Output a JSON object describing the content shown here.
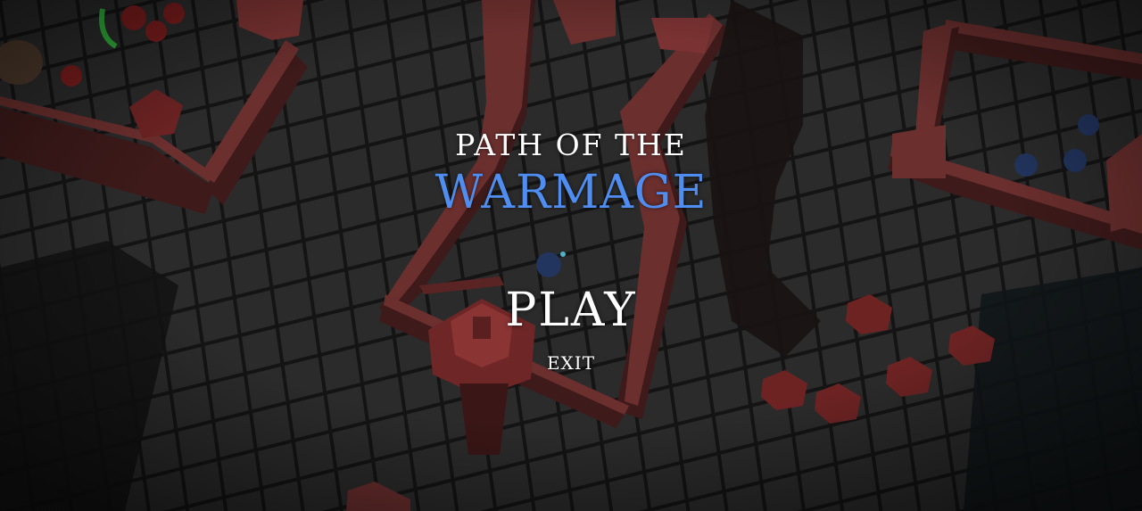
{
  "menu": {
    "title_line1": "PATH OF THE",
    "title_line2": "WARMAGE",
    "play_label": "PLAY",
    "exit_label": "EXIT"
  },
  "colors": {
    "title_accent": "#4f8ef0",
    "menu_text": "#ffffff",
    "floor": "#2b2b2b",
    "grid_line": "#141414",
    "wall": "#6b2f2e",
    "wall_dark": "#3e1a1a",
    "enemy_red": "#7a1c1c",
    "enemy_blue": "#22355f",
    "highlight_green": "#2fae3a"
  },
  "scene": {
    "description_icons": [
      "castle-wall",
      "tower",
      "red-soldier",
      "blue-soldier",
      "spike-trap"
    ]
  }
}
